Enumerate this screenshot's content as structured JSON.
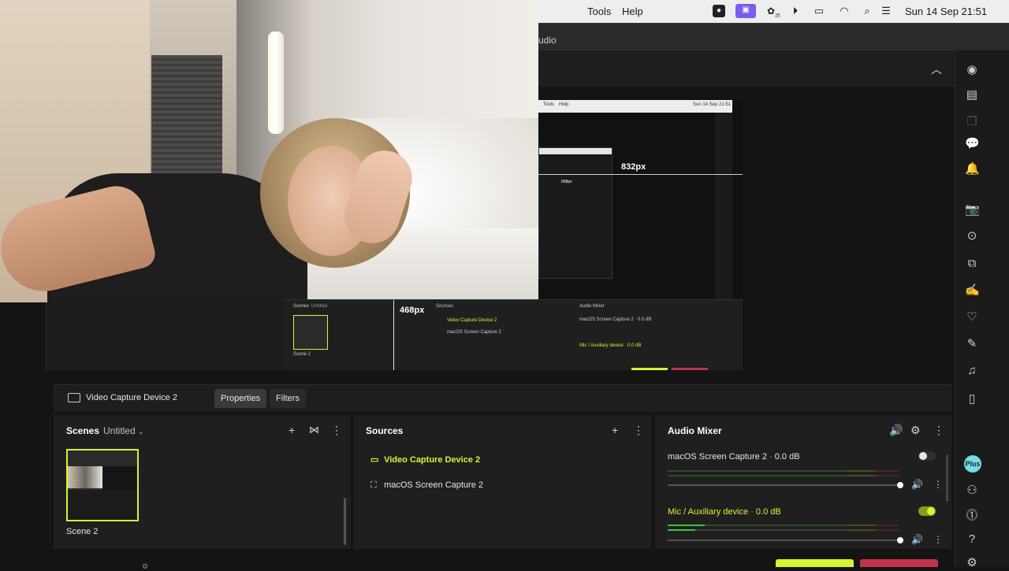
{
  "menubar": {
    "items": [
      "Tools",
      "Help"
    ],
    "datetime": "Sun 14 Sep  21:51",
    "badge_count": "25"
  },
  "titlestrip": {
    "text": "udio"
  },
  "preview": {
    "width_label": "832px",
    "height_label": "468px",
    "nested": {
      "menubar": [
        "Tools",
        "Help",
        "Sun 14 Sep  21:51"
      ],
      "inner_width_label": "668px",
      "scenes_title": "Scenes",
      "scenes_sub": "Untitled",
      "scene_label": "Scene 2",
      "sources_title": "Sources",
      "source_1": "Video Capture Device 2",
      "source_2": "macOS Screen Capture 2",
      "mixer_title": "Audio Mixer",
      "channel_1": "macOS Screen Capture 2 · 0.0 dB",
      "channel_2": "Mic / Auxiliary device · 0.0 dB"
    }
  },
  "source_toolbar": {
    "selected_source": "Video Capture Device 2",
    "properties_label": "Properties",
    "filters_label": "Filters"
  },
  "scenes": {
    "title": "Scenes",
    "collection": "Untitled",
    "items": [
      {
        "label": "Scene 2",
        "selected": true
      }
    ]
  },
  "sources": {
    "title": "Sources",
    "items": [
      {
        "label": "Video Capture Device 2",
        "icon": "camera-icon",
        "selected": true
      },
      {
        "label": "macOS Screen Capture 2",
        "icon": "screen-capture-icon",
        "selected": false
      }
    ]
  },
  "mixer": {
    "title": "Audio Mixer",
    "channels": [
      {
        "name": "macOS Screen Capture 2",
        "level": "0.0 dB",
        "enabled": false,
        "volume": 1.0
      },
      {
        "name": "Mic / Auxiliary device",
        "level": "0.0 dB",
        "enabled": true,
        "volume": 1.0
      }
    ]
  },
  "sidebar": {
    "plus_label": "Plus"
  },
  "colors": {
    "accent": "#d7f432",
    "record": "#c0334d",
    "plus": "#79d9e6"
  }
}
